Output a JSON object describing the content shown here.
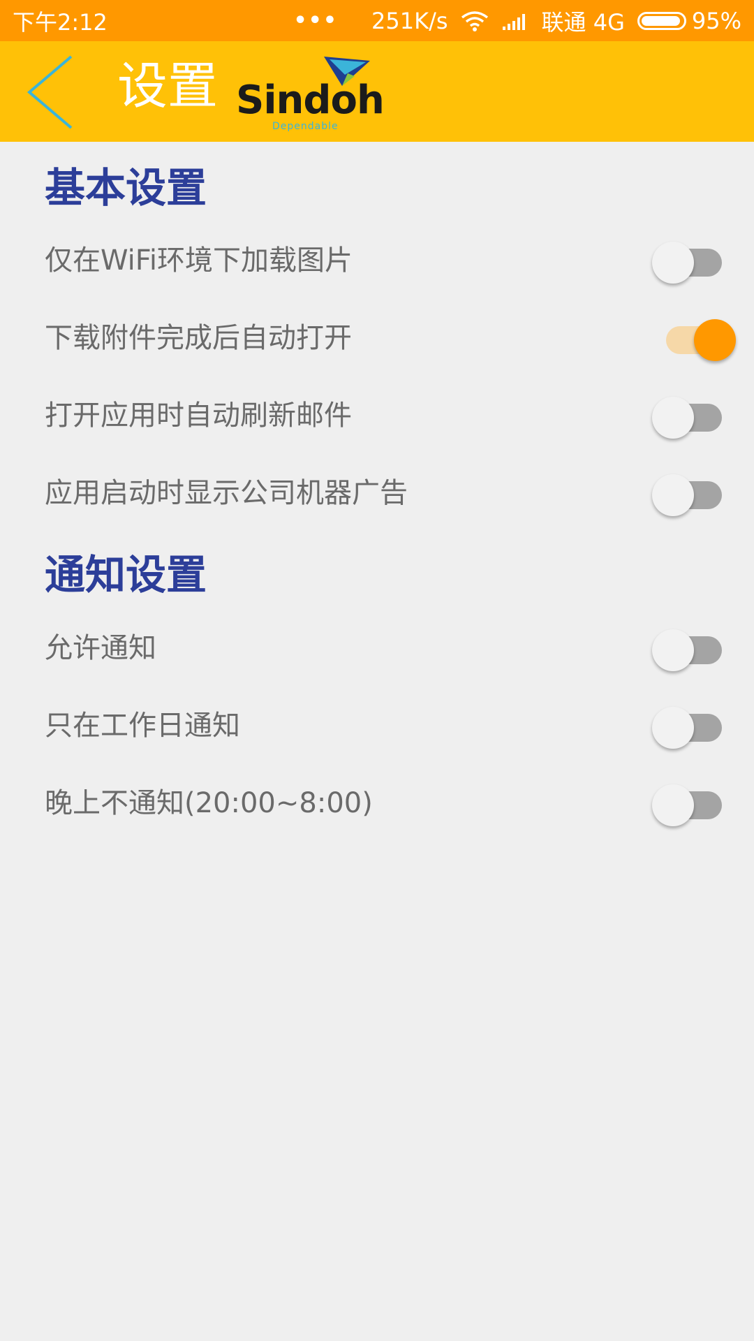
{
  "status_bar": {
    "time": "下午2:12",
    "dots": "•••",
    "speed": "251K/s",
    "carrier": "联通 4G",
    "battery_pct": "95%",
    "battery_level": 0.95
  },
  "app_bar": {
    "title": "设置",
    "logo_text": "Sindoh",
    "logo_sub": "Dependable"
  },
  "sections": [
    {
      "title": "基本设置",
      "items": [
        {
          "label": "仅在WiFi环境下加载图片",
          "on": false
        },
        {
          "label": "下载附件完成后自动打开",
          "on": true
        },
        {
          "label": "打开应用时自动刷新邮件",
          "on": false
        },
        {
          "label": "应用启动时显示公司机器广告",
          "on": false
        }
      ]
    },
    {
      "title": "通知设置",
      "items": [
        {
          "label": "允许通知",
          "on": false
        },
        {
          "label": "只在工作日通知",
          "on": false
        },
        {
          "label": "晚上不通知(20:00~8:00)",
          "on": false
        }
      ]
    }
  ],
  "colors": {
    "status_bar": "#ff9800",
    "app_bar": "#ffc107",
    "section_title": "#2c3e99",
    "switch_on": "#ff9800"
  }
}
